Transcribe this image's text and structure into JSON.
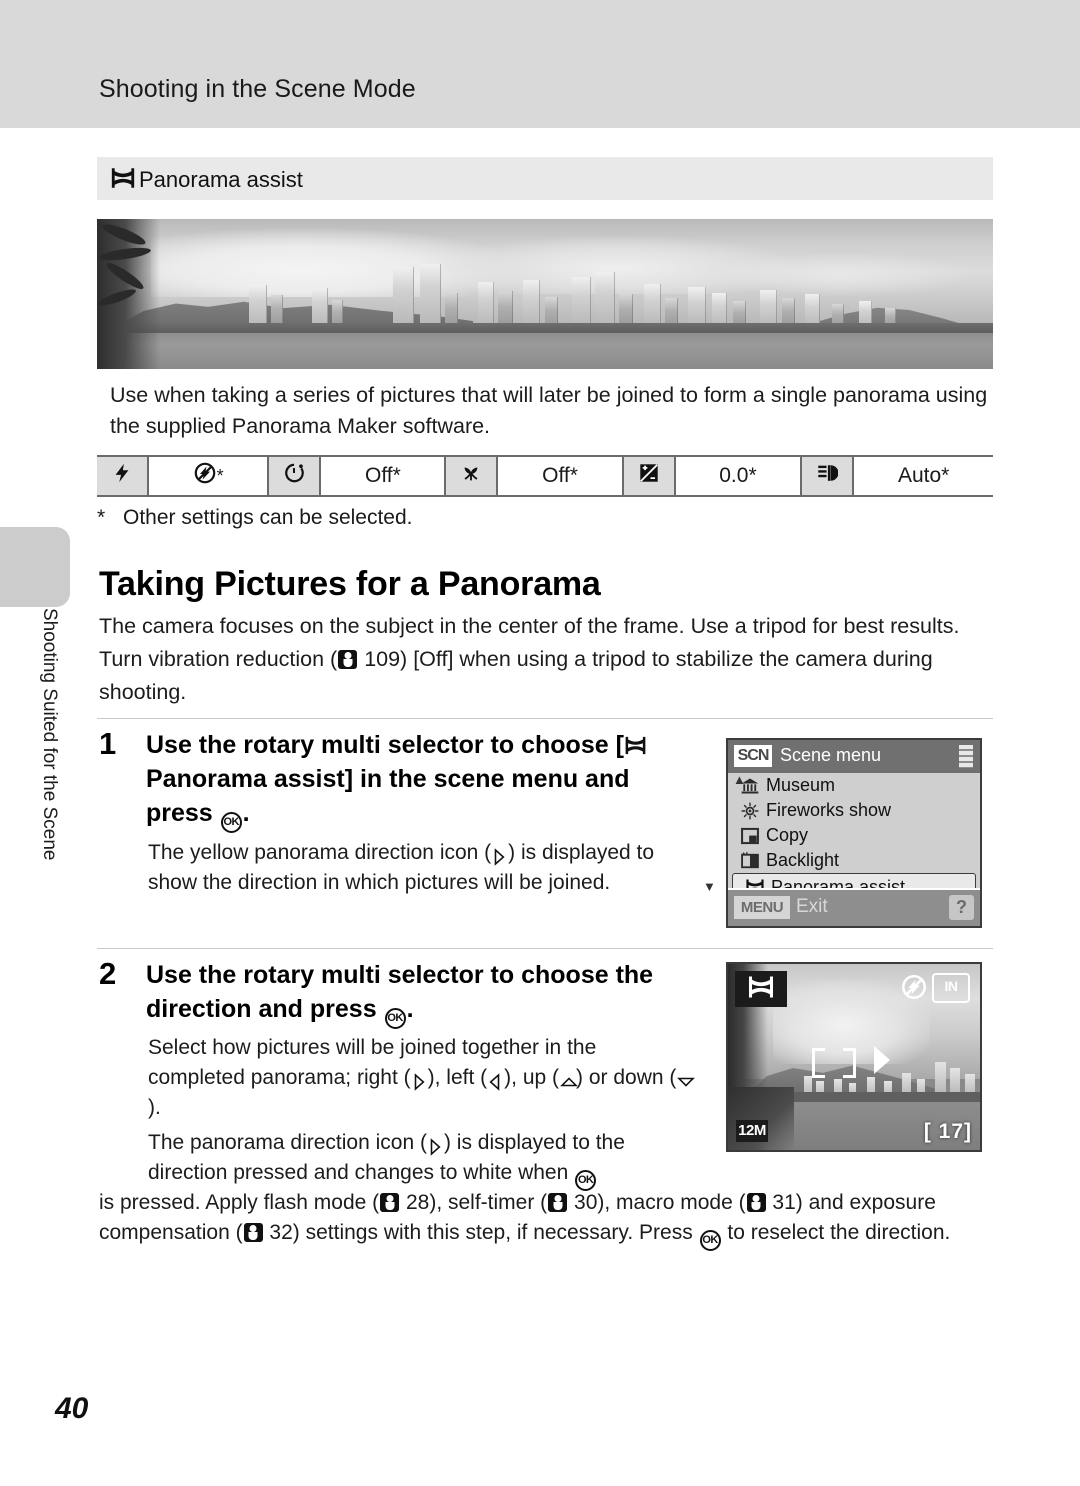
{
  "header": {
    "title": "Shooting in the Scene Mode"
  },
  "side_tab": {
    "label": "Shooting Suited for the Scene"
  },
  "scene_banner": {
    "icon": "panorama-assist-icon",
    "label": "Panorama assist"
  },
  "photo": {
    "alt": "Grayscale panorama of a city skyline across a bay with palm fronds at left"
  },
  "description": "Use when taking a series of pictures that will later be joined to form a single panorama using the supplied Panorama Maker software.",
  "settings_strip": {
    "cells": [
      {
        "type": "icon",
        "icon": "flash-icon",
        "value": ""
      },
      {
        "type": "value",
        "icon": "flash-off-icon",
        "value": "*"
      },
      {
        "type": "icon",
        "icon": "self-timer-icon",
        "value": ""
      },
      {
        "type": "value",
        "icon": "",
        "value": "Off*"
      },
      {
        "type": "icon",
        "icon": "macro-flower-icon",
        "value": ""
      },
      {
        "type": "value",
        "icon": "",
        "value": "Off*"
      },
      {
        "type": "icon",
        "icon": "exposure-compensation-icon",
        "value": ""
      },
      {
        "type": "value",
        "icon": "",
        "value": "0.0*"
      },
      {
        "type": "icon",
        "icon": "image-mode-icon",
        "value": ""
      },
      {
        "type": "value",
        "icon": "",
        "value": "Auto*"
      }
    ],
    "footnote_marker": "*",
    "footnote": "Other settings can be selected."
  },
  "section": {
    "heading": "Taking Pictures for a Panorama",
    "lead_part1": "The camera focuses on the subject in the center of the frame. Use a tripod for best results. Turn vibration reduction (",
    "lead_ref": "109) [Off] when using a tripod to stabilize the camera during shooting.",
    "lead_ref_number": "109"
  },
  "steps": [
    {
      "number": "1",
      "title_part1": "Use the rotary multi selector to choose [",
      "title_part2": " Panorama assist] in the scene menu and press ",
      "title_part3": ".",
      "body_part1": "The yellow panorama direction icon (",
      "body_part2": ") is displayed to show the direction in which pictures will be joined."
    },
    {
      "number": "2",
      "title_part1": "Use the rotary multi selector to choose the direction and press ",
      "title_part2": ".",
      "body1_part1": "Select how pictures will be joined together in the completed panorama; right (",
      "body1_part2": "), left (",
      "body1_part3": "), up (",
      "body1_part4": ") or down (",
      "body1_part5": ").",
      "body2_part1": "The panorama direction icon (",
      "body2_part2": ") is displayed to the direction pressed and changes to white when ",
      "body2_part3": " is pressed. Apply flash mode (",
      "body2_ref1": "28), self-timer (",
      "body2_ref2": "30), macro mode (",
      "body2_ref3": "31) and exposure compensation (",
      "body2_ref4": "32) settings with this step, if necessary. Press ",
      "body2_part_end": " to reselect the direction.",
      "refs": [
        "28",
        "30",
        "31",
        "32"
      ]
    }
  ],
  "lcd_scene_menu": {
    "badge": "SCN",
    "title": "Scene menu",
    "items": [
      {
        "label": "Museum",
        "icon": "museum-icon",
        "selected": false
      },
      {
        "label": "Fireworks show",
        "icon": "fireworks-icon",
        "selected": false
      },
      {
        "label": "Copy",
        "icon": "copy-icon",
        "selected": false
      },
      {
        "label": "Backlight",
        "icon": "backlight-icon",
        "selected": false
      },
      {
        "label": "Panorama assist",
        "icon": "panorama-assist-icon",
        "selected": true
      }
    ],
    "footer_badge": "MENU",
    "footer_label": "Exit",
    "help_button": "?"
  },
  "lcd_live_view": {
    "mode_icon": "panorama-assist-icon",
    "flash_icon": "flash-off-icon",
    "memory_label": "IN",
    "image_mode": "12M",
    "shots_remaining": "[  17]",
    "direction_icon": "right-arrow-icon"
  },
  "page_number": "40",
  "colors": {
    "header_band": "#d9d9d9",
    "banner": "#e9e9e9",
    "side_tab": "#cccccc",
    "lcd_header": "#707070",
    "lcd_body": "#cfcfcf",
    "lcd_footer": "#8e8e8e",
    "rule": "#c9c9c9"
  }
}
